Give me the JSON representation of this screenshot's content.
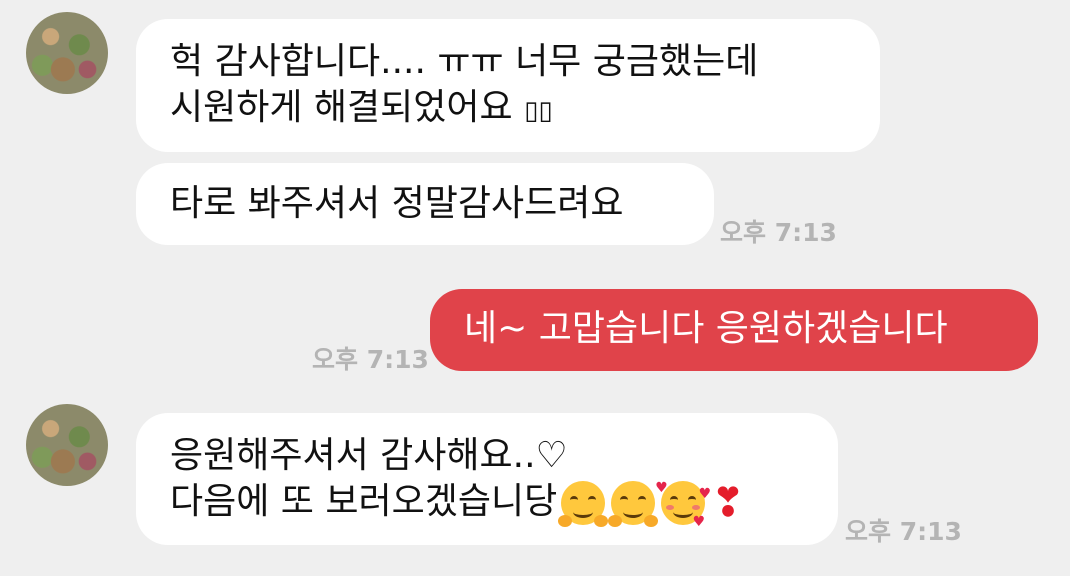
{
  "messages": {
    "incoming_1": {
      "line1": "헉 감사합니다....  ㅠㅠ 너무 궁금했는데",
      "line2": "시원하게 해결되었어요 ",
      "box_glyphs": "▯▯"
    },
    "incoming_2": {
      "text": "타로 봐주셔서 정말감사드려요",
      "time": "오후 7:13"
    },
    "outgoing_1": {
      "text": "네~ 고맙습니다 응원하겠습니다",
      "time": "오후 7:13"
    },
    "incoming_3": {
      "line1": "응원해주셔서 감사해요..♡",
      "line2": "다음에 또 보러오겠습니당",
      "heart": "❣",
      "time": "오후 7:13"
    }
  },
  "emojis": [
    "hugging-face-icon",
    "hugging-face-icon",
    "smiling-face-with-hearts-icon",
    "heavy-heart-exclamation-icon"
  ],
  "colors": {
    "background": "#efefef",
    "incoming_bubble": "#ffffff",
    "outgoing_bubble": "#e0434a",
    "timestamp": "#b4b4b4"
  }
}
